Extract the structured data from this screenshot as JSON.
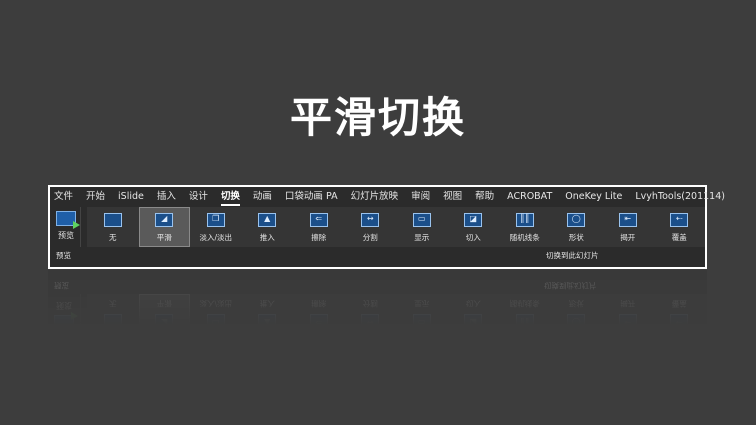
{
  "slide": {
    "title": "平滑切换"
  },
  "ribbon": {
    "tabs": [
      {
        "label": "文件",
        "active": false
      },
      {
        "label": "开始",
        "active": false
      },
      {
        "label": "iSlide",
        "active": false
      },
      {
        "label": "插入",
        "active": false
      },
      {
        "label": "设计",
        "active": false
      },
      {
        "label": "切换",
        "active": true
      },
      {
        "label": "动画",
        "active": false
      },
      {
        "label": "口袋动画 PA",
        "active": false
      },
      {
        "label": "幻灯片放映",
        "active": false
      },
      {
        "label": "审阅",
        "active": false
      },
      {
        "label": "视图",
        "active": false
      },
      {
        "label": "帮助",
        "active": false
      },
      {
        "label": "ACROBAT",
        "active": false
      },
      {
        "label": "OneKey Lite",
        "active": false
      },
      {
        "label": "LvyhTools(201114)",
        "active": false
      }
    ],
    "preview_button": {
      "label": "预览",
      "icon": "preview-play-icon"
    },
    "effects": [
      {
        "label": "无",
        "icon": "none-transition-icon",
        "selected": false
      },
      {
        "label": "平滑",
        "icon": "morph-transition-icon",
        "selected": true
      },
      {
        "label": "淡入/淡出",
        "icon": "fade-transition-icon",
        "selected": false
      },
      {
        "label": "推入",
        "icon": "push-transition-icon",
        "selected": false
      },
      {
        "label": "擦除",
        "icon": "wipe-transition-icon",
        "selected": false
      },
      {
        "label": "分割",
        "icon": "split-transition-icon",
        "selected": false
      },
      {
        "label": "显示",
        "icon": "reveal-transition-icon",
        "selected": false
      },
      {
        "label": "切入",
        "icon": "cut-transition-icon",
        "selected": false
      },
      {
        "label": "随机线条",
        "icon": "random-bars-transition-icon",
        "selected": false
      },
      {
        "label": "形状",
        "icon": "shape-transition-icon",
        "selected": false
      },
      {
        "label": "揭开",
        "icon": "uncover-transition-icon",
        "selected": false
      },
      {
        "label": "覆盖",
        "icon": "cover-transition-icon",
        "selected": false
      }
    ],
    "groups": {
      "preview": "预览",
      "transitions": "切换到此幻灯片"
    }
  },
  "colors": {
    "background": "#3d3d3d",
    "ribbon": "#2b2b2b",
    "accent": "#1b4f8a",
    "outline": "#ffffff"
  }
}
